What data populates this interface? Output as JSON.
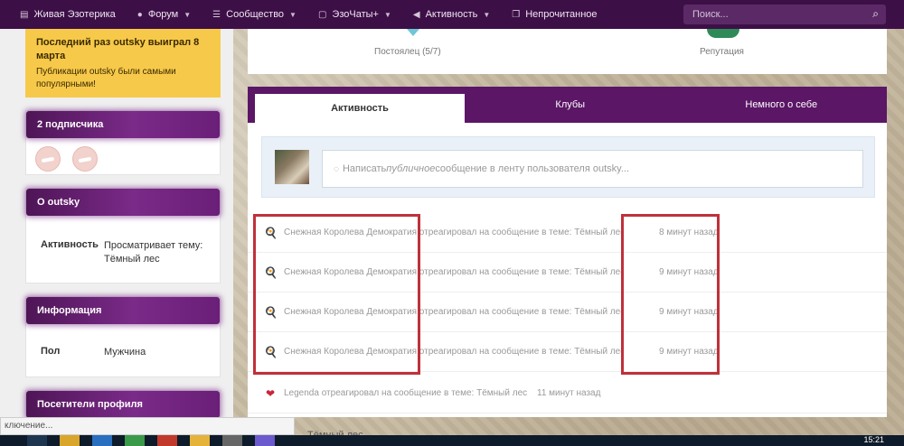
{
  "nav": {
    "items": [
      {
        "label": "Живая Эзотерика",
        "icon": "document-icon",
        "caret": false
      },
      {
        "label": "Форум",
        "icon": "chat-icon",
        "caret": true
      },
      {
        "label": "Сообщество",
        "icon": "list-icon",
        "caret": true
      },
      {
        "label": "ЭзоЧаты+",
        "icon": "chat-bubble-icon",
        "caret": true
      },
      {
        "label": "Активность",
        "icon": "megaphone-icon",
        "caret": true
      },
      {
        "label": "Непрочитанное",
        "icon": "copy-icon",
        "caret": false
      }
    ],
    "search_placeholder": "Поиск..."
  },
  "notice": {
    "title": "Последний раз outsky выиграл 8 марта",
    "text": "Публикации outsky были самыми популярными!"
  },
  "followers": {
    "title": "2 подписчика"
  },
  "about": {
    "title": "О outsky",
    "key": "Активность",
    "value": "Просматривает тему: Тёмный лес"
  },
  "info": {
    "title": "Информация",
    "key": "Пол",
    "value": "Мужчина"
  },
  "visitors": {
    "title": "Посетители профиля"
  },
  "stats": {
    "left": "Постоялец (5/7)",
    "right": "Репутация"
  },
  "tabs": [
    "Активность",
    "Клубы",
    "Немного о себе"
  ],
  "composer": {
    "prefix": "Написать ",
    "italic": "публичное",
    "suffix": " сообщение в ленту пользователя outsky..."
  },
  "feed": [
    {
      "text": "Снежная Королева Демократия отреагировал на сообщение в теме: Тёмный лес",
      "time": "8 минут назад",
      "icon": "frying-pan-icon"
    },
    {
      "text": "Снежная Королева Демократия отреагировал на сообщение в теме: Тёмный лес",
      "time": "9 минут назад",
      "icon": "frying-pan-icon"
    },
    {
      "text": "Снежная Королева Демократия отреагировал на сообщение в теме: Тёмный лес",
      "time": "9 минут назад",
      "icon": "frying-pan-icon"
    },
    {
      "text": "Снежная Королева Демократия отреагировал на сообщение в теме: Тёмный лес",
      "time": "9 минут назад",
      "icon": "frying-pan-icon"
    },
    {
      "text": "Legenda отреагировал на сообщение в теме: Тёмный лес",
      "time": "11 минут назад",
      "icon": "heart-icon"
    }
  ],
  "partial_text": "Тёмный лес",
  "status": "ключение...",
  "clock": "15:21",
  "colors": {
    "nav": "#3d0f47",
    "accent": "#5b1666",
    "notice": "#f7c94a",
    "highlight": "#c0303a"
  }
}
